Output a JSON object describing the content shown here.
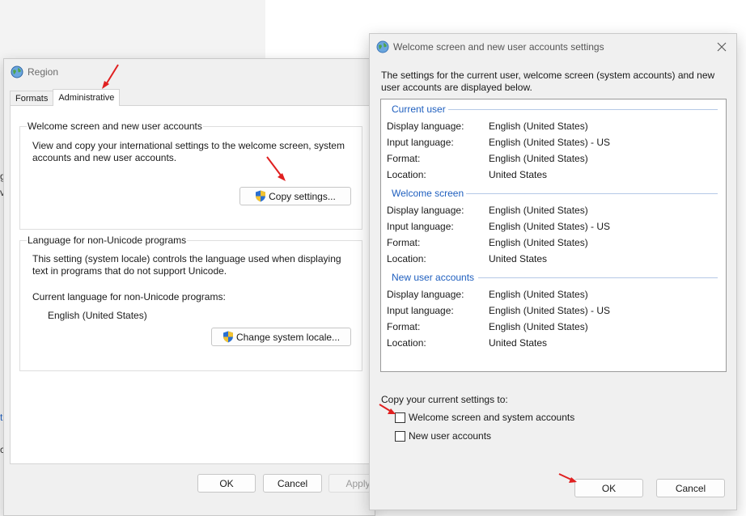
{
  "background": {
    "edge_glyphs": [
      "g",
      "v",
      "t",
      "c"
    ]
  },
  "region": {
    "title": "Region",
    "tabs": [
      {
        "label": "Formats",
        "active": false
      },
      {
        "label": "Administrative",
        "active": true
      }
    ],
    "welcome_group": {
      "title": "Welcome screen and new user accounts",
      "description": "View and copy your international settings to the welcome screen, system accounts and new user accounts.",
      "copy_button": "Copy settings..."
    },
    "unicode_group": {
      "title": "Language for non-Unicode programs",
      "description": "This setting (system locale) controls the language used when displaying text in programs that do not support Unicode.",
      "current_label": "Current language for non-Unicode programs:",
      "current_value": "English (United States)",
      "change_button": "Change system locale..."
    },
    "footer": {
      "ok": "OK",
      "cancel": "Cancel",
      "apply": "Apply"
    }
  },
  "welcome": {
    "title": "Welcome screen and new user accounts settings",
    "intro": "The settings for the current user, welcome screen (system accounts) and new user accounts are displayed below.",
    "sections": [
      {
        "title": "Current user",
        "rows": [
          {
            "label": "Display language:",
            "value": "English (United States)"
          },
          {
            "label": "Input language:",
            "value": "English (United States) - US"
          },
          {
            "label": "Format:",
            "value": "English (United States)"
          },
          {
            "label": "Location:",
            "value": "United States"
          }
        ]
      },
      {
        "title": "Welcome screen",
        "rows": [
          {
            "label": "Display language:",
            "value": "English (United States)"
          },
          {
            "label": "Input language:",
            "value": "English (United States) - US"
          },
          {
            "label": "Format:",
            "value": "English (United States)"
          },
          {
            "label": "Location:",
            "value": "United States"
          }
        ]
      },
      {
        "title": "New user accounts",
        "rows": [
          {
            "label": "Display language:",
            "value": "English (United States)"
          },
          {
            "label": "Input language:",
            "value": "English (United States) - US"
          },
          {
            "label": "Format:",
            "value": "English (United States)"
          },
          {
            "label": "Location:",
            "value": "United States"
          }
        ]
      }
    ],
    "copy_to_label": "Copy your current settings to:",
    "checkboxes": [
      {
        "label": "Welcome screen and system accounts",
        "checked": false
      },
      {
        "label": "New user accounts",
        "checked": false
      }
    ],
    "ok": "OK",
    "cancel": "Cancel"
  },
  "colors": {
    "arrow": "#e02020",
    "section_heading": "#1f5fbf"
  },
  "icons": {
    "app": "globe-icon",
    "uac": "shield-icon",
    "close": "close-icon"
  }
}
